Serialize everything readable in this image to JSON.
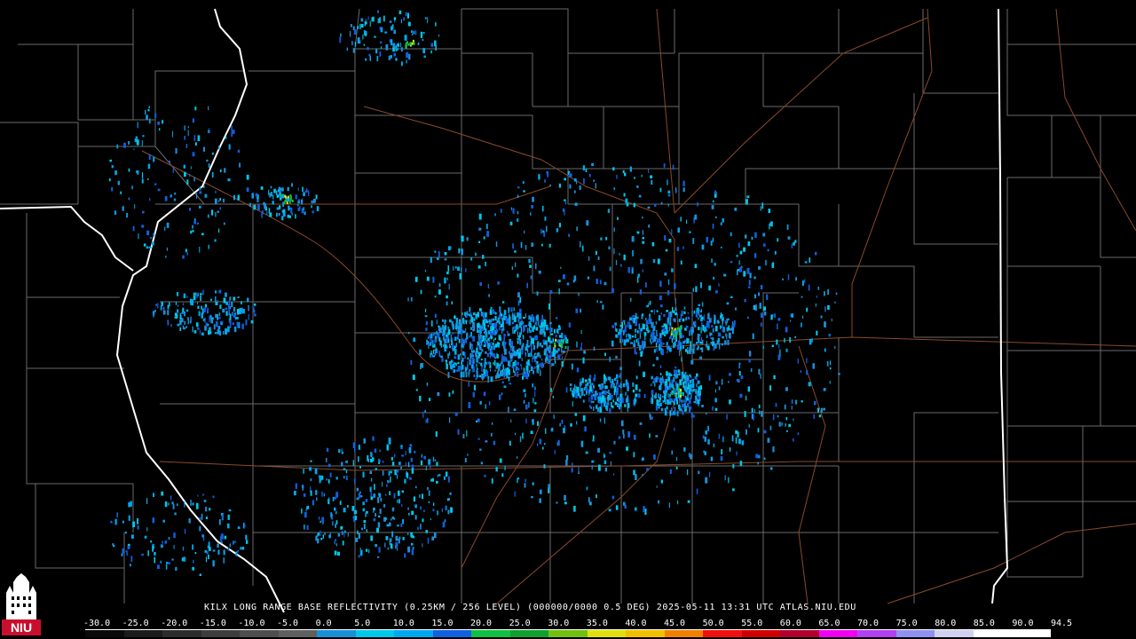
{
  "header": {
    "caption": "KILX LONG RANGE BASE REFLECTIVITY (0.25KM / 256 LEVEL) (000000/0000 0.5 DEG) 2025-05-11 13:31 UTC  ATLAS.NIU.EDU"
  },
  "logo": {
    "text": "NIU"
  },
  "legend": {
    "labels": [
      "-30.0",
      "-25.0",
      "-20.0",
      "-15.0",
      "-10.0",
      "-5.0",
      "0.0",
      "5.0",
      "10.0",
      "15.0",
      "20.0",
      "25.0",
      "30.0",
      "35.0",
      "40.0",
      "45.0",
      "50.0",
      "55.0",
      "60.0",
      "65.0",
      "70.0",
      "75.0",
      "80.0",
      "85.0",
      "90.0",
      "94.5"
    ],
    "colors": [
      "#0a0a0a",
      "#1b1b1b",
      "#2c2c2c",
      "#3d3d3d",
      "#4e4e4e",
      "#5f5f5f",
      "#1b8fd6",
      "#00c8e8",
      "#00a8f0",
      "#1060e0",
      "#10c040",
      "#10a030",
      "#70c010",
      "#e0e010",
      "#f0c000",
      "#f08000",
      "#f01010",
      "#d00000",
      "#b00030",
      "#f000f0",
      "#b040f0",
      "#9090f0",
      "#d0d0f0",
      "#ffffff",
      "#ffffff"
    ]
  },
  "colors": {
    "background": "#000000",
    "county_border": "#6a6a6a",
    "state_border": "#ffffff",
    "highway": "#8a4a2a"
  }
}
